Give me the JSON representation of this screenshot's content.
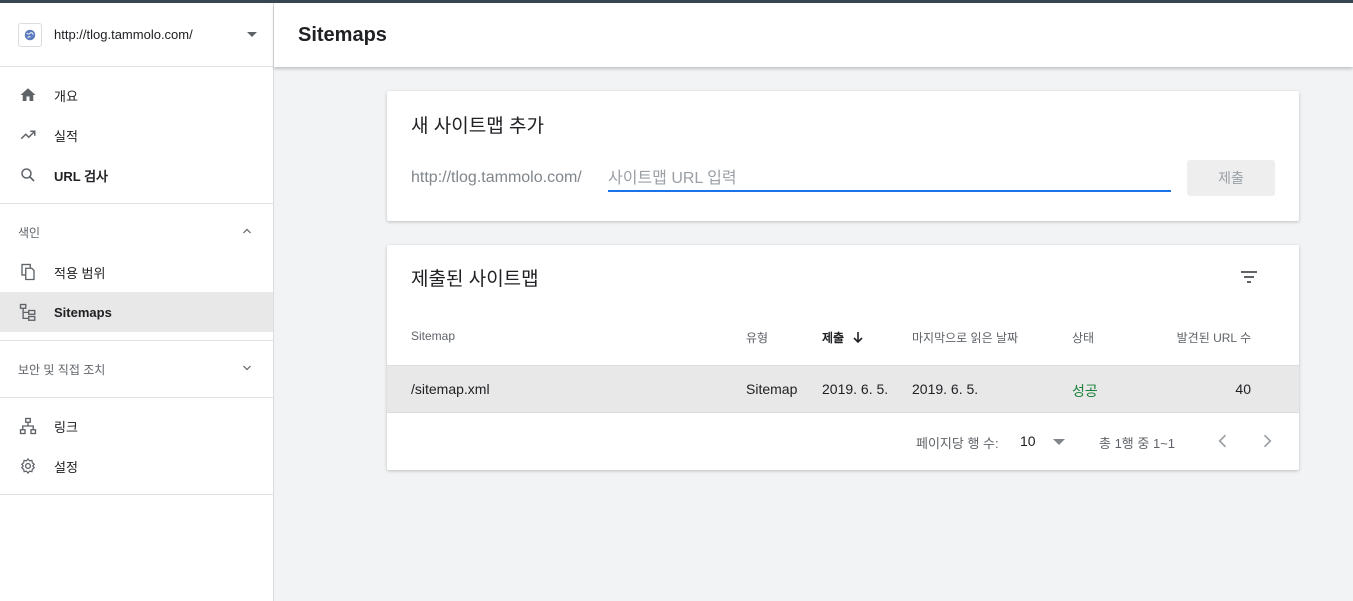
{
  "property": {
    "url": "http://tlog.tammolo.com/",
    "icon": "globe-icon"
  },
  "nav": {
    "main": [
      {
        "label": "개요",
        "icon": "home-icon"
      },
      {
        "label": "실적",
        "icon": "trending-up-icon"
      },
      {
        "label": "URL 검사",
        "icon": "search-icon"
      }
    ],
    "index_section": "색인",
    "index_items": [
      {
        "label": "적용 범위",
        "icon": "copy-icon"
      },
      {
        "label": "Sitemaps",
        "icon": "sitemap-icon"
      }
    ],
    "security_section": "보안 및 직접 조치",
    "other": [
      {
        "label": "링크",
        "icon": "link-tree-icon"
      },
      {
        "label": "설정",
        "icon": "gear-icon"
      }
    ]
  },
  "header": {
    "title": "Sitemaps"
  },
  "add": {
    "title": "새 사이트맵 추가",
    "prefix": "http://tlog.tammolo.com/",
    "placeholder": "사이트맵 URL 입력",
    "submit": "제출"
  },
  "submitted": {
    "title": "제출된 사이트맵",
    "columns": {
      "sitemap": "Sitemap",
      "type": "유형",
      "submitted": "제출",
      "last_read": "마지막으로 읽은 날짜",
      "status": "상태",
      "discovered": "발견된 URL 수"
    },
    "rows": [
      {
        "sitemap": "/sitemap.xml",
        "type": "Sitemap",
        "submitted": "2019. 6. 5.",
        "last_read": "2019. 6. 5.",
        "status": "성공",
        "discovered": "40"
      }
    ],
    "pagination": {
      "rows_label": "페이지당 행 수:",
      "rows_value": "10",
      "range": "총 1행 중 1~1"
    }
  },
  "colors": {
    "accent": "#1a73e8",
    "success": "#188038",
    "active_bg": "#e8e8e8"
  }
}
